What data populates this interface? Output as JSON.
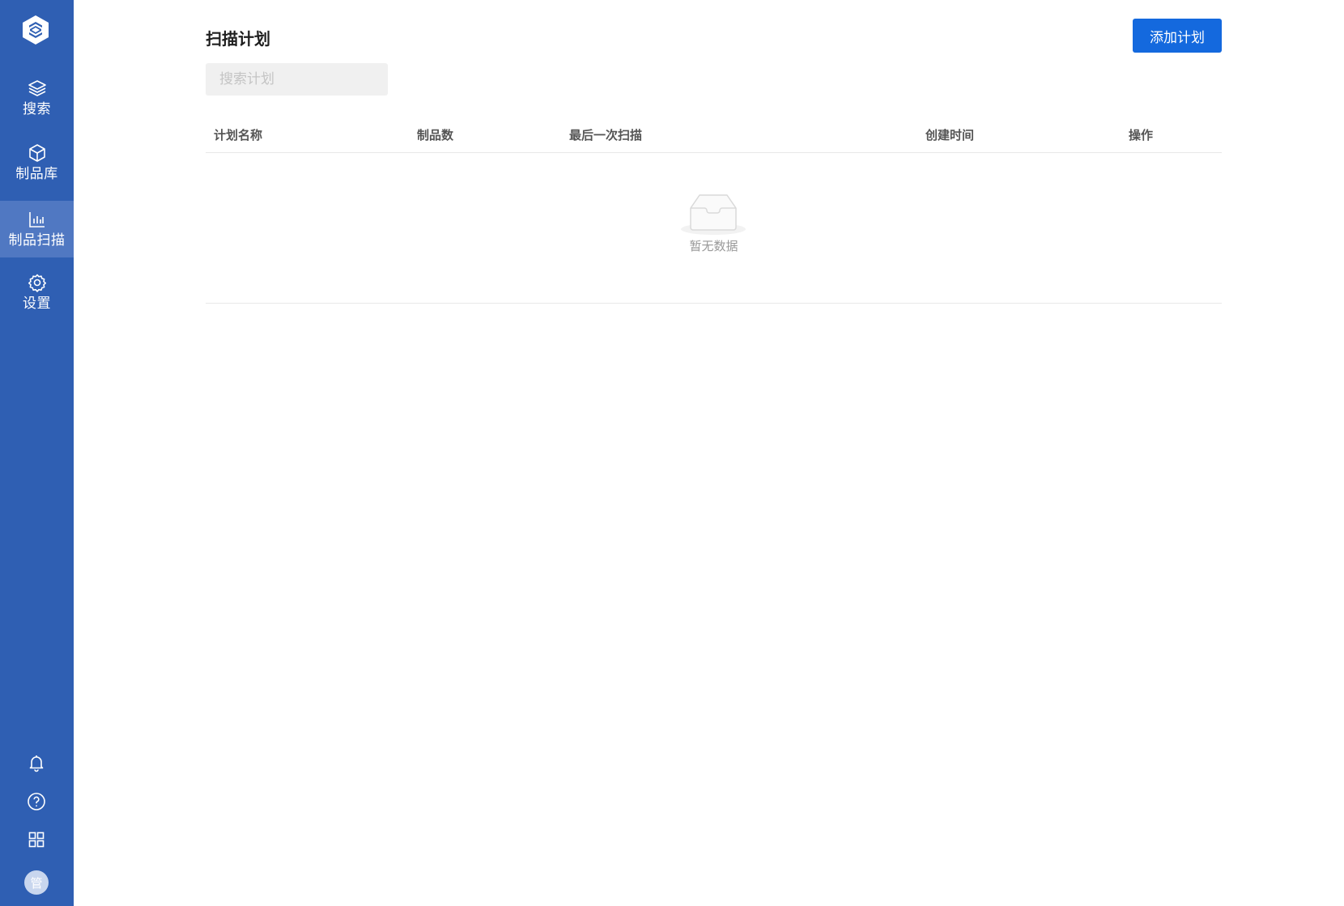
{
  "sidebar": {
    "logo_icon": "product-logo",
    "items": [
      {
        "label": "搜索",
        "icon": "layers-icon",
        "active": false
      },
      {
        "label": "制品库",
        "icon": "box-icon",
        "active": false
      },
      {
        "label": "制品扫描",
        "icon": "bar-chart-icon",
        "active": true
      },
      {
        "label": "设置",
        "icon": "gear-icon",
        "active": false
      }
    ],
    "bottom_icons": [
      "bell-icon",
      "help-icon",
      "grid-icon"
    ],
    "avatar_text": "管"
  },
  "page": {
    "title": "扫描计划",
    "add_button_label": "添加计划",
    "search_placeholder": "搜索计划"
  },
  "table": {
    "columns": [
      "计划名称",
      "制品数",
      "最后一次扫描",
      "创建时间",
      "操作"
    ],
    "rows": [],
    "empty_text": "暂无数据"
  },
  "colors": {
    "sidebar_bg": "#2f5fb3",
    "sidebar_active": "#5078c2",
    "primary_button": "#1469de"
  }
}
